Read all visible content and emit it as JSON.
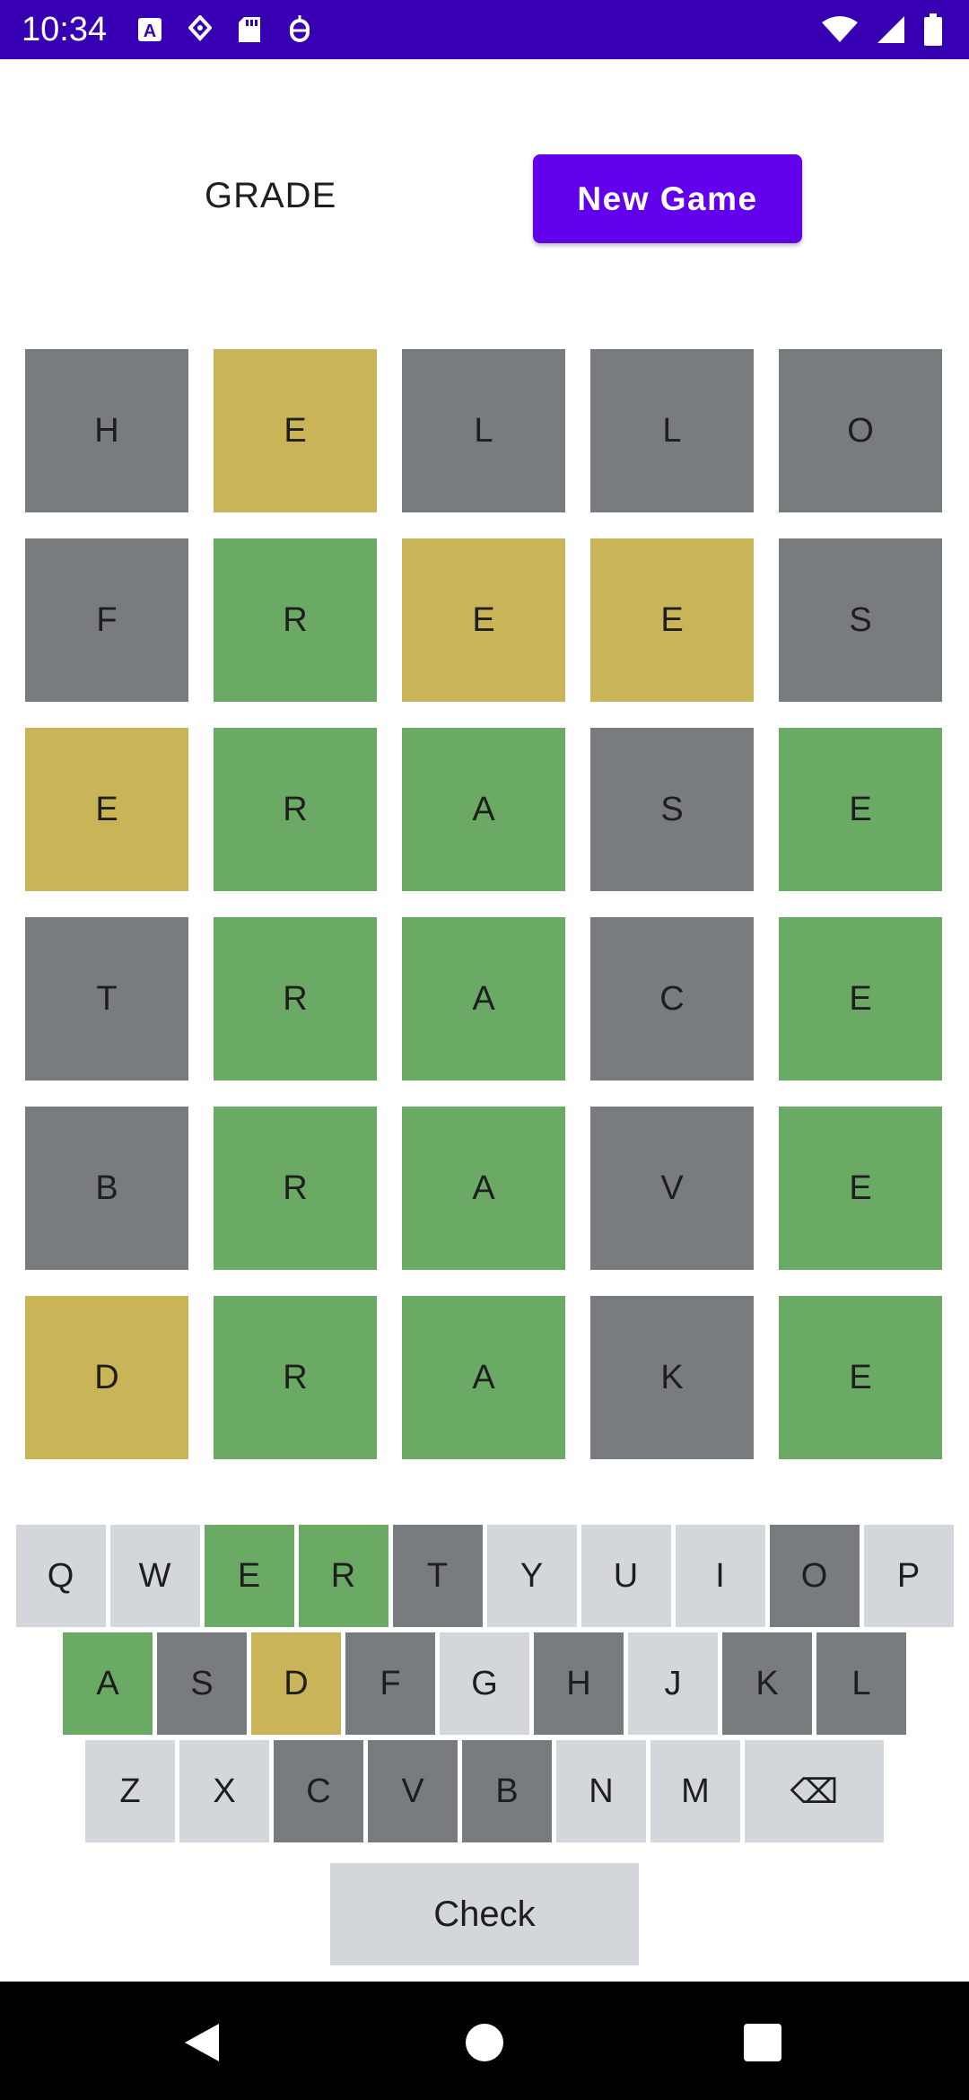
{
  "status_bar": {
    "time": "10:34",
    "left_icons": [
      "a-box-icon",
      "location-marker-icon",
      "sd-card-icon",
      "bug-icon"
    ],
    "right_icons": [
      "wifi-icon",
      "signal-icon",
      "battery-icon"
    ]
  },
  "header": {
    "grade_label": "GRADE",
    "new_game_label": "New Game"
  },
  "colors": {
    "gray": "#787c7e",
    "yellow": "#c9b458",
    "green": "#6aaa64",
    "key_default": "#d3d6da",
    "accent": "#6200ee",
    "status_bar": "#3700b3"
  },
  "board": {
    "rows": [
      [
        {
          "letter": "H",
          "state": "gray"
        },
        {
          "letter": "E",
          "state": "yellow"
        },
        {
          "letter": "L",
          "state": "gray"
        },
        {
          "letter": "L",
          "state": "gray"
        },
        {
          "letter": "O",
          "state": "gray"
        }
      ],
      [
        {
          "letter": "F",
          "state": "gray"
        },
        {
          "letter": "R",
          "state": "green"
        },
        {
          "letter": "E",
          "state": "yellow"
        },
        {
          "letter": "E",
          "state": "yellow"
        },
        {
          "letter": "S",
          "state": "gray"
        }
      ],
      [
        {
          "letter": "E",
          "state": "yellow"
        },
        {
          "letter": "R",
          "state": "green"
        },
        {
          "letter": "A",
          "state": "green"
        },
        {
          "letter": "S",
          "state": "gray"
        },
        {
          "letter": "E",
          "state": "green"
        }
      ],
      [
        {
          "letter": "T",
          "state": "gray"
        },
        {
          "letter": "R",
          "state": "green"
        },
        {
          "letter": "A",
          "state": "green"
        },
        {
          "letter": "C",
          "state": "gray"
        },
        {
          "letter": "E",
          "state": "green"
        }
      ],
      [
        {
          "letter": "B",
          "state": "gray"
        },
        {
          "letter": "R",
          "state": "green"
        },
        {
          "letter": "A",
          "state": "green"
        },
        {
          "letter": "V",
          "state": "gray"
        },
        {
          "letter": "E",
          "state": "green"
        }
      ],
      [
        {
          "letter": "D",
          "state": "yellow"
        },
        {
          "letter": "R",
          "state": "green"
        },
        {
          "letter": "A",
          "state": "green"
        },
        {
          "letter": "K",
          "state": "gray"
        },
        {
          "letter": "E",
          "state": "green"
        }
      ]
    ]
  },
  "keyboard": {
    "rows": [
      [
        {
          "key": "Q",
          "state": "default"
        },
        {
          "key": "W",
          "state": "default"
        },
        {
          "key": "E",
          "state": "green"
        },
        {
          "key": "R",
          "state": "green"
        },
        {
          "key": "T",
          "state": "gray"
        },
        {
          "key": "Y",
          "state": "default"
        },
        {
          "key": "U",
          "state": "default"
        },
        {
          "key": "I",
          "state": "default"
        },
        {
          "key": "O",
          "state": "gray"
        },
        {
          "key": "P",
          "state": "default"
        }
      ],
      [
        {
          "key": "A",
          "state": "green"
        },
        {
          "key": "S",
          "state": "gray"
        },
        {
          "key": "D",
          "state": "yellow"
        },
        {
          "key": "F",
          "state": "gray"
        },
        {
          "key": "G",
          "state": "default"
        },
        {
          "key": "H",
          "state": "gray"
        },
        {
          "key": "J",
          "state": "default"
        },
        {
          "key": "K",
          "state": "gray"
        },
        {
          "key": "L",
          "state": "gray"
        }
      ],
      [
        {
          "key": "Z",
          "state": "default"
        },
        {
          "key": "X",
          "state": "default"
        },
        {
          "key": "C",
          "state": "gray"
        },
        {
          "key": "V",
          "state": "gray"
        },
        {
          "key": "B",
          "state": "gray"
        },
        {
          "key": "N",
          "state": "default"
        },
        {
          "key": "M",
          "state": "default"
        },
        {
          "key": "⌫",
          "state": "default",
          "name": "backspace"
        }
      ]
    ],
    "check_label": "Check"
  },
  "nav_bar": {
    "icons": [
      "back-icon",
      "home-icon",
      "recents-icon"
    ]
  }
}
